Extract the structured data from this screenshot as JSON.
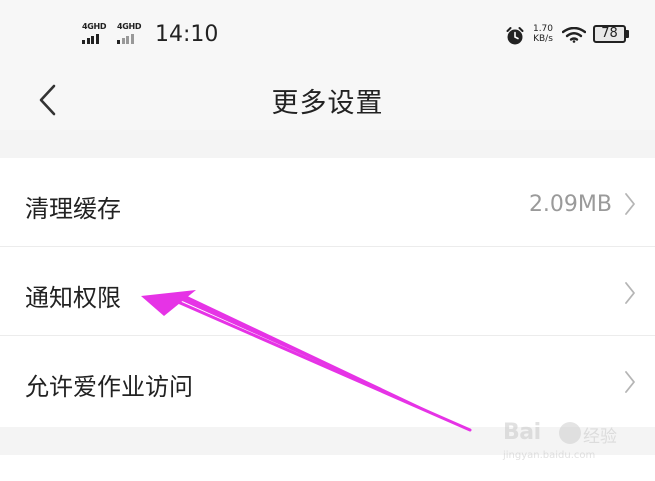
{
  "status_bar": {
    "signal_1": "4GHD",
    "signal_2": "4GHD",
    "time": "14:10",
    "net_speed_value": "1.70",
    "net_speed_unit": "KB/s",
    "battery": "78",
    "icons": [
      "signal-icon",
      "alarm-icon",
      "wifi-icon",
      "battery-icon"
    ]
  },
  "nav": {
    "title": "更多设置",
    "back_icon": "chevron-left-icon"
  },
  "settings": {
    "items": [
      {
        "label": "清理缓存",
        "value": "2.09MB",
        "icon": "chevron-right-icon"
      },
      {
        "label": "通知权限",
        "value": "",
        "icon": "chevron-right-icon"
      },
      {
        "label": "允许爱作业访问",
        "value": "",
        "icon": "chevron-right-icon"
      }
    ]
  },
  "annotation": {
    "color": "#e633e6",
    "shape": "arrow"
  },
  "watermark": {
    "brand": "Bai",
    "suffix": "经验",
    "url": "jingyan.baidu.com"
  },
  "colors": {
    "background": "#ffffff",
    "header": "#f7f7f7",
    "separator": "#f4f4f4",
    "secondary_text": "#9a9a9a"
  }
}
